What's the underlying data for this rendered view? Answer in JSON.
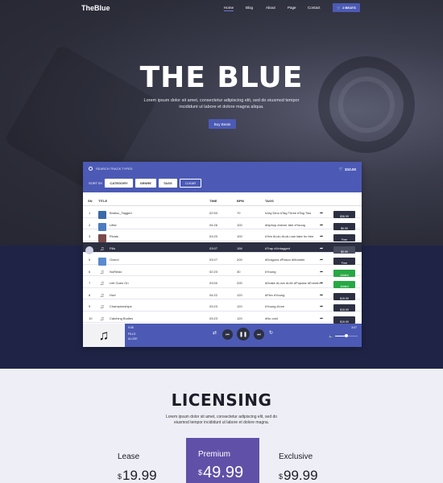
{
  "nav": {
    "logo": "TheBlue",
    "items": [
      "Home",
      "Blog",
      "About",
      "Page",
      "Contact"
    ],
    "cart_label": "2 BEATS"
  },
  "hero": {
    "title": "THE BLUE",
    "subtitle_line1": "Lorem ipsum dolor sit amet, consectetur adipiscing elit, sed do eiusmod tempor",
    "subtitle_line2": "incididunt ut labore et dolore magna aliqua.",
    "button": "Buy Beats"
  },
  "panel": {
    "search_placeholder": "SEARCH TRACK TYPES",
    "cart_total": "$10.00",
    "sort_label": "SORT BY",
    "filters": [
      "CATEGORY",
      "GENRE",
      "TAGS"
    ],
    "clear": "CLEAR",
    "columns": [
      "SN",
      "TITLE",
      "TIME",
      "BPM",
      "TAGS"
    ],
    "rows": [
      {
        "sn": "1",
        "title": "Bndloc_Tagged",
        "time": "02:53",
        "bpm": "70",
        "tags": "#Jay Dino #Tag Three #Tag Two",
        "price": "$36.99",
        "kind": "price",
        "thumb": "#3a6aa8",
        "icon": "image"
      },
      {
        "sn": "2",
        "title": "Lifter",
        "time": "04:26",
        "bpm": "100",
        "tags": "#hiphop #never #be #Young",
        "price": "$9.99",
        "kind": "price",
        "thumb": "#4c7bc0",
        "icon": "image"
      },
      {
        "sn": "3",
        "title": "Rivals",
        "time": "03:20",
        "bpm": "100",
        "tags": "#Yes #Lulu #Lulu can take #o free",
        "price": "Free",
        "kind": "free",
        "thumb": "#7a4a4a",
        "icon": "image"
      },
      {
        "sn": "4",
        "title": "Fills",
        "time": "03:07",
        "bpm": "156",
        "tags": "#Trap #Untagged",
        "price": "$9.99",
        "kind": "price",
        "thumb": "",
        "icon": "note",
        "active": true
      },
      {
        "sn": "5",
        "title": "Overcl",
        "time": "03:27",
        "bpm": "200",
        "tags": "#Dragons #Pasco #Monster",
        "price": "Free",
        "kind": "free",
        "thumb": "#5a8ad0",
        "icon": "image"
      },
      {
        "sn": "6",
        "title": "NoRelax",
        "time": "02:23",
        "bpm": "30",
        "tags": "#Young",
        "price": "Added",
        "kind": "added",
        "thumb": "",
        "icon": "note"
      },
      {
        "sn": "7",
        "title": "Life Goes On",
        "time": "03:00",
        "bpm": "200",
        "tags": "#Drake #Love #Life #Popular #Eventh",
        "price": "Added",
        "kind": "added",
        "thumb": "",
        "icon": "note"
      },
      {
        "sn": "8",
        "title": "Hurt",
        "time": "04:22",
        "bpm": "120",
        "tags": "#Flex #Young",
        "price": "$19.99",
        "kind": "price",
        "thumb": "",
        "icon": "note"
      },
      {
        "sn": "9",
        "title": "Championships",
        "time": "03:23",
        "bpm": "120",
        "tags": "#Young #Live",
        "price": "$19.99",
        "kind": "price",
        "thumb": "",
        "icon": "note"
      },
      {
        "sn": "10",
        "title": "Catching Bodies",
        "time": "03:23",
        "bpm": "120",
        "tags": "#No cold",
        "price": "$19.99",
        "kind": "price",
        "thumb": "",
        "icon": "note"
      }
    ]
  },
  "player": {
    "time": "0:36",
    "title": "FILLS",
    "artist": "ALOSE",
    "duration": "3:07",
    "volume": 0.5
  },
  "licensing": {
    "title": "LICENSING",
    "subtitle_line1": "Lorem ipsum dolor sit amet, consectetur adipiscing elit, sed do",
    "subtitle_line2": "eiusmod tempor incididunt ut labore et dolore magna.",
    "plans": [
      {
        "name": "Lease",
        "currency": "$",
        "amount": "19.99"
      },
      {
        "name": "Premium",
        "currency": "$",
        "amount": "49.99"
      },
      {
        "name": "Exclusive",
        "currency": "$",
        "amount": "99.99"
      }
    ]
  }
}
